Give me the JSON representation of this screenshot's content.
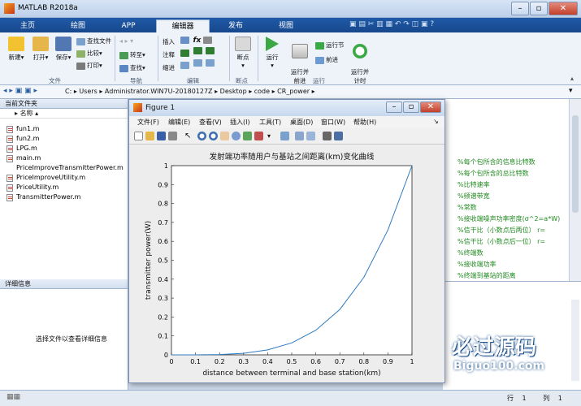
{
  "window": {
    "title": "MATLAB R2018a"
  },
  "tabs": [
    {
      "label": "主页"
    },
    {
      "label": "绘图"
    },
    {
      "label": "APP"
    },
    {
      "label": "编辑器"
    },
    {
      "label": "发布"
    },
    {
      "label": "视图"
    }
  ],
  "search": {
    "placeholder": "搜索文档"
  },
  "ribbon": {
    "new": "新建",
    "open": "打开",
    "save": "保存",
    "find_files": "查找文件",
    "compare": "比较",
    "print": "打印",
    "goto": "转至",
    "find": "查找",
    "insert": "插入",
    "comment": "注释",
    "indent": "缩进",
    "fx": "fx",
    "breakpoints": "断点",
    "run": "运行",
    "run_advance": "运行并\n前进",
    "run_section": "运行节",
    "advance": "前进",
    "run_time": "运行并\n计时",
    "groups": {
      "file": "文件",
      "nav": "导航",
      "edit": "编辑",
      "bp": "断点",
      "run": "运行"
    }
  },
  "address": {
    "path": [
      "C:",
      "Users",
      "Administrator.WIN7U-20180127Z",
      "Desktop",
      "code",
      "CR_power"
    ]
  },
  "folder_panel": {
    "title": "当前文件夹",
    "column": "名称",
    "files": [
      "fun1.m",
      "fun2.m",
      "LPG.m",
      "main.m",
      "PriceImproveTransmitterPower.m",
      "PriceImproveUtility.m",
      "PriceUtility.m",
      "TransmitterPower.m"
    ]
  },
  "details": {
    "title": "详细信息",
    "hint": "选择文件以查看详细信息"
  },
  "editor_comments": [
    "%每个包所含的信息比特数",
    "%每个包所含的总比特数",
    "%比特速率",
    "%频谱带宽",
    "%常数",
    "%接收端噪声功率密度(σ^2=a*W)",
    "%信干比（小数点后两位）  r=",
    "%信干比（小数点后一位）  r=",
    "%终端数",
    "%接收端功率",
    "%终端到基站的距离"
  ],
  "status": {
    "row_label": "行",
    "row": "1",
    "col_label": "列",
    "col": "1"
  },
  "figure": {
    "title": "Figure 1",
    "menus": [
      "文件(F)",
      "编辑(E)",
      "查看(V)",
      "插入(I)",
      "工具(T)",
      "桌面(D)",
      "窗口(W)",
      "帮助(H)"
    ]
  },
  "watermark": {
    "text": "必过源码",
    "url": "Biguo100.com"
  },
  "colors": {
    "ribbon_blue": "#1f5aa6",
    "line": "#2f7bbf",
    "comment": "#228b22"
  },
  "chart_data": {
    "type": "line",
    "title": "发射端功率随用户与基站之间距离(km)变化曲线",
    "xlabel": "distance between terminal and base station(km)",
    "ylabel": "transmitter power(W)",
    "xlim": [
      0,
      1
    ],
    "ylim": [
      0,
      1
    ],
    "xticks": [
      "0",
      "0.1",
      "0.2",
      "0.3",
      "0.4",
      "0.5",
      "0.6",
      "0.7",
      "0.8",
      "0.9",
      "1"
    ],
    "yticks": [
      "0",
      "0.1",
      "0.2",
      "0.3",
      "0.4",
      "0.5",
      "0.6",
      "0.7",
      "0.8",
      "0.9",
      "1"
    ],
    "x": [
      0,
      0.1,
      0.2,
      0.3,
      0.4,
      0.5,
      0.6,
      0.7,
      0.8,
      0.9,
      1.0
    ],
    "y": [
      0,
      0.0001,
      0.0016,
      0.008,
      0.026,
      0.063,
      0.13,
      0.24,
      0.41,
      0.66,
      1.0
    ],
    "grid": false
  }
}
